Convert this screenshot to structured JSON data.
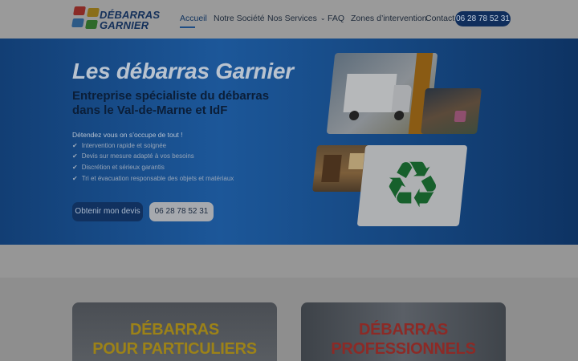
{
  "header": {
    "logo": {
      "line1": "DÉBARRAS",
      "line2": "GARNIER"
    },
    "nav": [
      {
        "label": "Accueil",
        "active": true
      },
      {
        "label": "Notre Société",
        "active": false
      },
      {
        "label": "Nos Services",
        "active": false,
        "has_dropdown": true,
        "icon": "chevron-down-icon"
      },
      {
        "label": "FAQ",
        "active": false
      },
      {
        "label": "Zones d’intervention",
        "active": false
      },
      {
        "label": "Contact",
        "active": false
      }
    ],
    "phone": "06 28 78 52 31"
  },
  "hero": {
    "title": "Les débarras Garnier",
    "subtitle": "Entreprise spécialiste du débarras dans le Val-de-Marne et IdF",
    "intro": "Détendez vous on s’occupe de tout !",
    "features": [
      "Intervention rapide et soignée",
      "Devis sur mesure adapté à vos besoins",
      "Discrétion et sérieux garantis",
      "Tri et évacuation responsable des objets et matériaux"
    ],
    "check_icon": "✔",
    "cta_quote": "Obtenir mon devis",
    "cta_phone": "06 28 78 52 31"
  },
  "cards": [
    {
      "title_line1": "DÉBARRAS",
      "title_line2": "POUR PARTICULIERS"
    },
    {
      "title_line1": "DÉBARRAS",
      "title_line2": "PROFESSIONNELS"
    }
  ],
  "colors": {
    "brand_navy": "#102e5c",
    "hero_blue": "#1c5799",
    "card1_title": "#9c8218",
    "card2_title": "#8c2a26",
    "recycle_green": "#17602c"
  }
}
